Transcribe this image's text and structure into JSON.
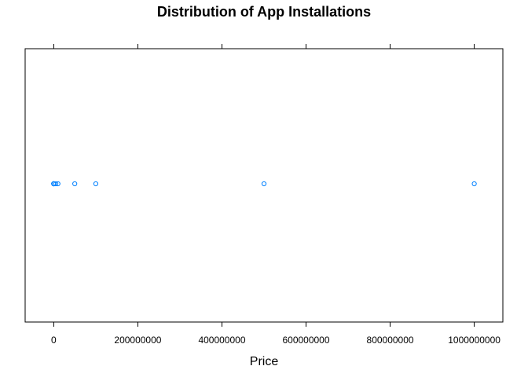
{
  "chart_data": {
    "type": "scatter",
    "title": "Distribution of App Installations",
    "xlabel": "Price",
    "ylabel": "",
    "xlim": [
      -68000000,
      1068000000
    ],
    "x_ticks": [
      0,
      200000000,
      400000000,
      600000000,
      800000000,
      1000000000
    ],
    "x_tick_labels": [
      "0",
      "200000000",
      "400000000",
      "600000000",
      "800000000",
      "1000000000"
    ],
    "grid": false,
    "legend": "none",
    "point_color": "#0080ff",
    "series": [
      {
        "values": [
          0,
          1000,
          5000,
          10000,
          50000,
          100000,
          500000,
          1000000,
          5000000,
          10000000,
          50000000,
          100000000,
          500000000,
          1000000000
        ]
      }
    ]
  }
}
